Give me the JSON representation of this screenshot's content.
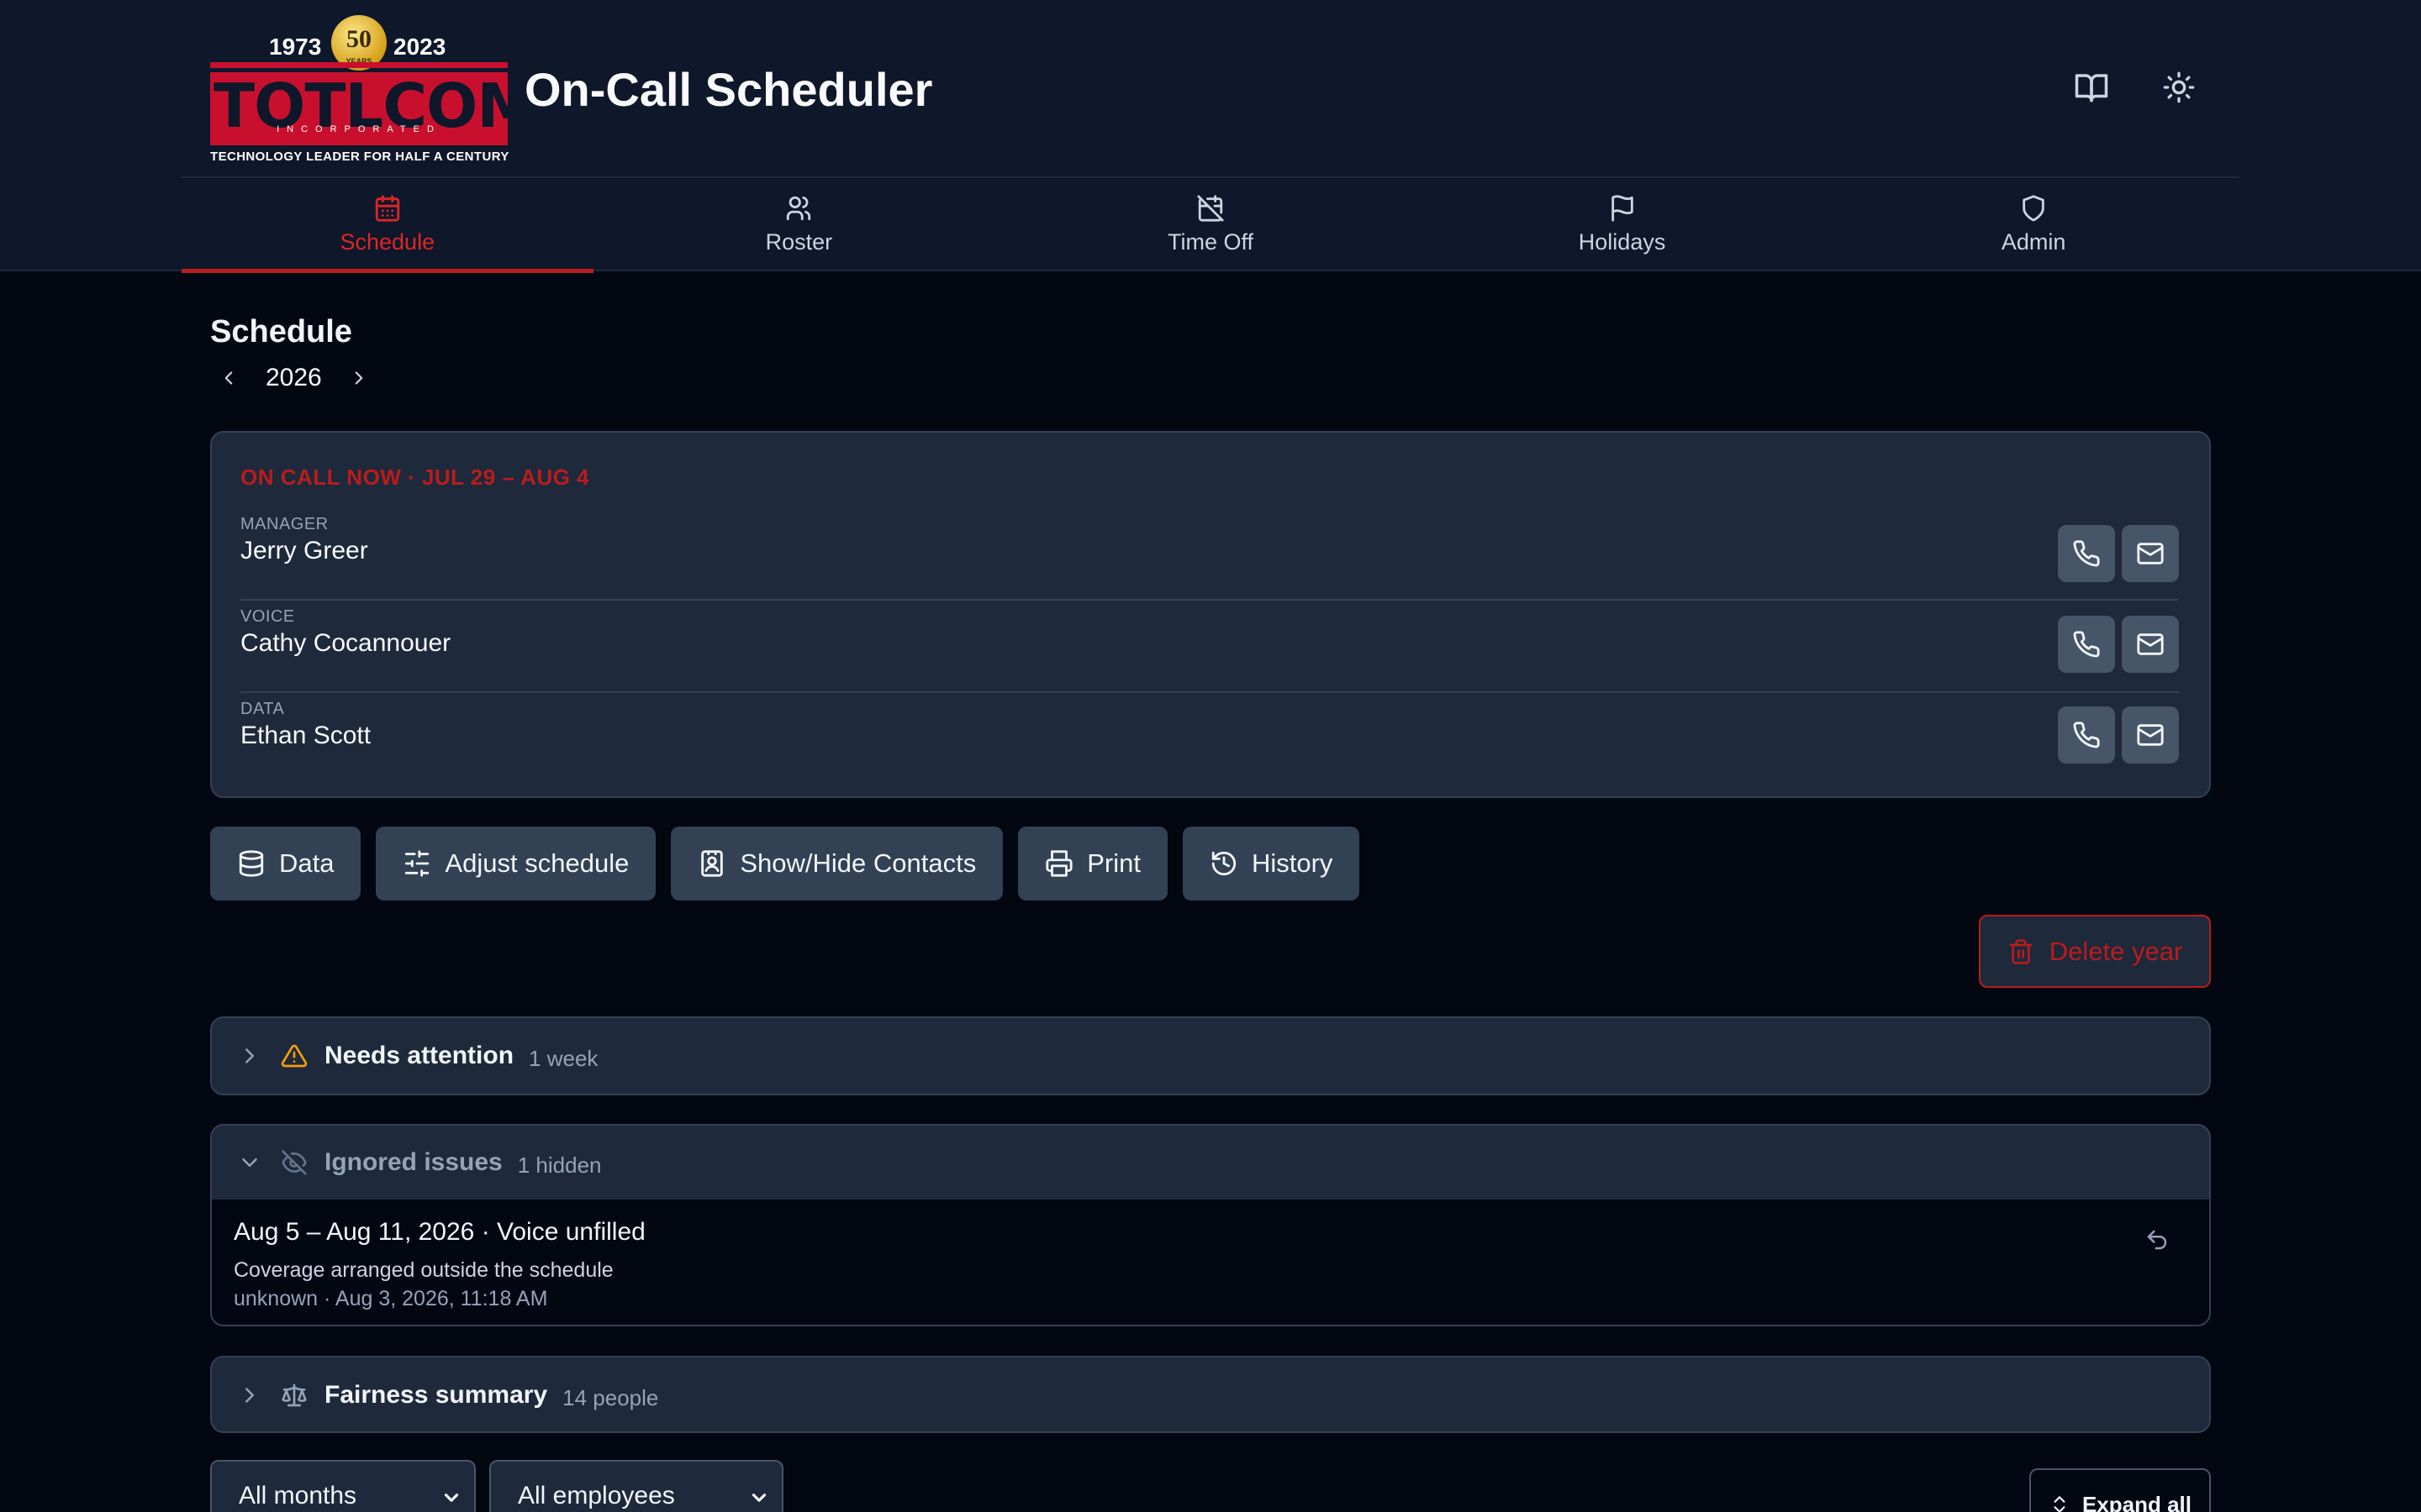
{
  "header": {
    "logo": {
      "year_start": "1973",
      "year_end": "2023",
      "seal_number": "50",
      "seal_sub": "YEARS",
      "wordmark": "TOTLCOM",
      "incorporated": "INCORPORATED",
      "tagline": "TECHNOLOGY LEADER FOR HALF A CENTURY"
    },
    "app_title": "On-Call Scheduler",
    "buttons": [
      {
        "icon": "book-icon"
      },
      {
        "icon": "sun-icon"
      }
    ]
  },
  "nav": {
    "tabs": [
      {
        "label": "Schedule",
        "icon": "calendar-icon",
        "active": true
      },
      {
        "label": "Roster",
        "icon": "users-icon",
        "active": false
      },
      {
        "label": "Time Off",
        "icon": "calendar-off-icon",
        "active": false
      },
      {
        "label": "Holidays",
        "icon": "flag-icon",
        "active": false
      },
      {
        "label": "Admin",
        "icon": "shield-icon",
        "active": false
      }
    ]
  },
  "page": {
    "title": "Schedule",
    "year": "2026"
  },
  "on_call": {
    "heading": "ON CALL NOW · JUL 29 – AUG 4",
    "people": [
      {
        "role": "MANAGER",
        "name": "Jerry Greer"
      },
      {
        "role": "VOICE",
        "name": "Cathy Cocannouer"
      },
      {
        "role": "DATA",
        "name": "Ethan Scott"
      }
    ]
  },
  "actions": {
    "data": "Data",
    "adjust": "Adjust schedule",
    "contacts": "Show/Hide Contacts",
    "print": "Print",
    "history": "History",
    "delete_year": "Delete year"
  },
  "sections": {
    "attention": {
      "title": "Needs attention",
      "count": "1 week"
    },
    "ignored": {
      "title": "Ignored issues",
      "count": "1 hidden",
      "items": [
        {
          "title": "Aug 5 – Aug 11, 2026 · Voice unfilled",
          "note": "Coverage arranged outside the schedule",
          "meta": "unknown · Aug 3, 2026, 11:18 AM"
        }
      ]
    },
    "fairness": {
      "title": "Fairness summary",
      "count": "14 people"
    }
  },
  "filters": {
    "month": "All months",
    "employee": "All employees",
    "expand_all": "Expand all"
  },
  "colors": {
    "accent": "#dc2626",
    "background": "#030712",
    "header": "#0f172a",
    "card": "#1e293b",
    "button": "#334155",
    "warning": "#f59e0b"
  }
}
